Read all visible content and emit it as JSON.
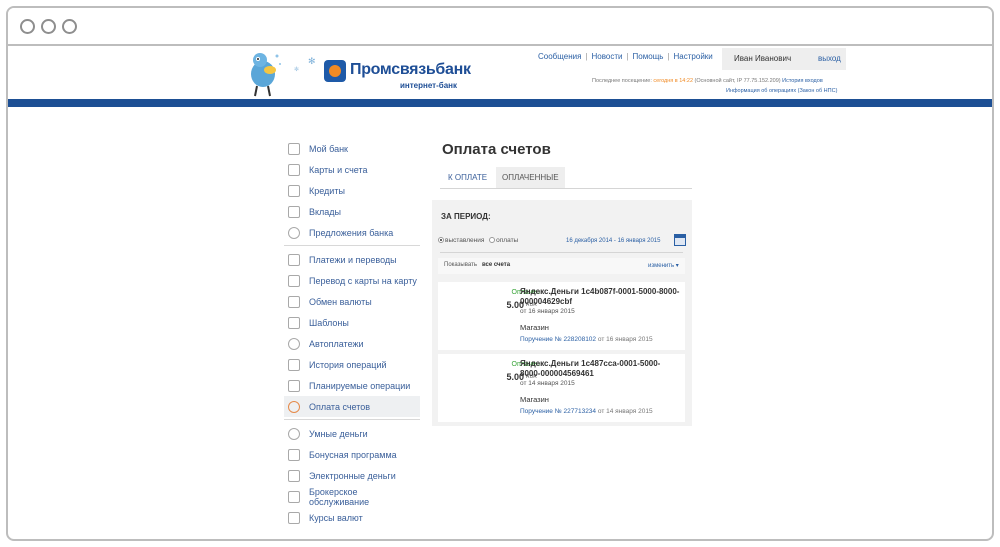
{
  "header": {
    "bank_name": "Промсвязьбанк",
    "bank_sub": "интернет-банк",
    "nav": [
      "Сообщения",
      "Новости",
      "Помощь",
      "Настройки"
    ],
    "user_name": "Иван Иванович",
    "logout": "выход",
    "last_visit_prefix": "Последнее посещение:",
    "last_visit_time": "сегодня в 14:22",
    "last_visit_site": "(Основной сайт, IP 77.75.152.209)",
    "login_history": "История входов",
    "operation_info": "Информация об операциях (Закон об НПС)"
  },
  "sidebar": {
    "group1": [
      "Мой банк",
      "Карты и счета",
      "Кредиты",
      "Вклады",
      "Предложения банка"
    ],
    "group2": [
      "Платежи и переводы",
      "Перевод с карты на карту",
      "Обмен валюты",
      "Шаблоны",
      "Автоплатежи",
      "История операций",
      "Планируемые операции",
      "Оплата счетов"
    ],
    "group3": [
      "Умные деньги",
      "Бонусная программа",
      "Электронные деньги",
      "Брокерское обслуживание",
      "Курсы валют"
    ],
    "active": "Оплата счетов"
  },
  "main": {
    "title": "Оплата счетов",
    "tabs": [
      "К ОПЛАТЕ",
      "ОПЛАЧЕННЫЕ"
    ],
    "active_tab": "ОПЛАЧЕННЫЕ",
    "period_label": "ЗА ПЕРИОД:",
    "radio_options": [
      "выставления",
      "оплаты"
    ],
    "radio_selected": "выставления",
    "date_range": "16 декабря 2014 - 16 января 2015",
    "show_label": "Показывать",
    "show_value": "все счета",
    "change_label": "изменить ▾",
    "bills": [
      {
        "status": "Оплачен",
        "amount": "5.00",
        "currency": "RUR",
        "name": "Яндекс.Деньги 1c4b087f-0001-5000-8000-000004629cbf",
        "date": "от 16 января 2015",
        "shop": "Магазин",
        "order_link": "Поручение № 228208102",
        "order_date": "от 16 января 2015"
      },
      {
        "status": "Оплачен",
        "amount": "5.00",
        "currency": "RUR",
        "name": "Яндекс.Деньги 1c487cca-0001-5000-8000-000004569461",
        "date": "от 14 января 2015",
        "shop": "Магазин",
        "order_link": "Поручение № 227713234",
        "order_date": "от 14 января 2015"
      }
    ]
  },
  "colors": {
    "brand_blue": "#1d4f94",
    "link_blue": "#2a5fa4",
    "accent_orange": "#f08a24",
    "paid_green": "#3aa53a"
  }
}
